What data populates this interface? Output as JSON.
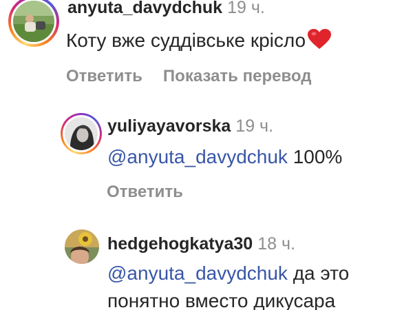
{
  "comments": [
    {
      "username": "anyuta_davydchuk",
      "time": "19 ч.",
      "text": "Коту вже суддівське крісло",
      "emoji": "heart-emoji",
      "actions": {
        "reply": "Ответить",
        "translate": "Показать перевод"
      },
      "avatar": "profile-photo"
    },
    {
      "username": "yuliyayavorska",
      "time": "19 ч.",
      "mention": "@anyuta_davydchuk",
      "text": "100%",
      "actions": {
        "reply": "Ответить"
      },
      "avatar": "profile-photo"
    },
    {
      "username": "hedgehogkatya30",
      "time": "18 ч.",
      "mention": "@anyuta_davydchuk",
      "text": "да это",
      "text_line2": "понятно вместо дикусара",
      "avatar": "profile-photo"
    }
  ],
  "colors": {
    "text": "#262626",
    "meta": "#8e8e8e",
    "mention": "#3856a8",
    "heart": "#e0242b"
  }
}
